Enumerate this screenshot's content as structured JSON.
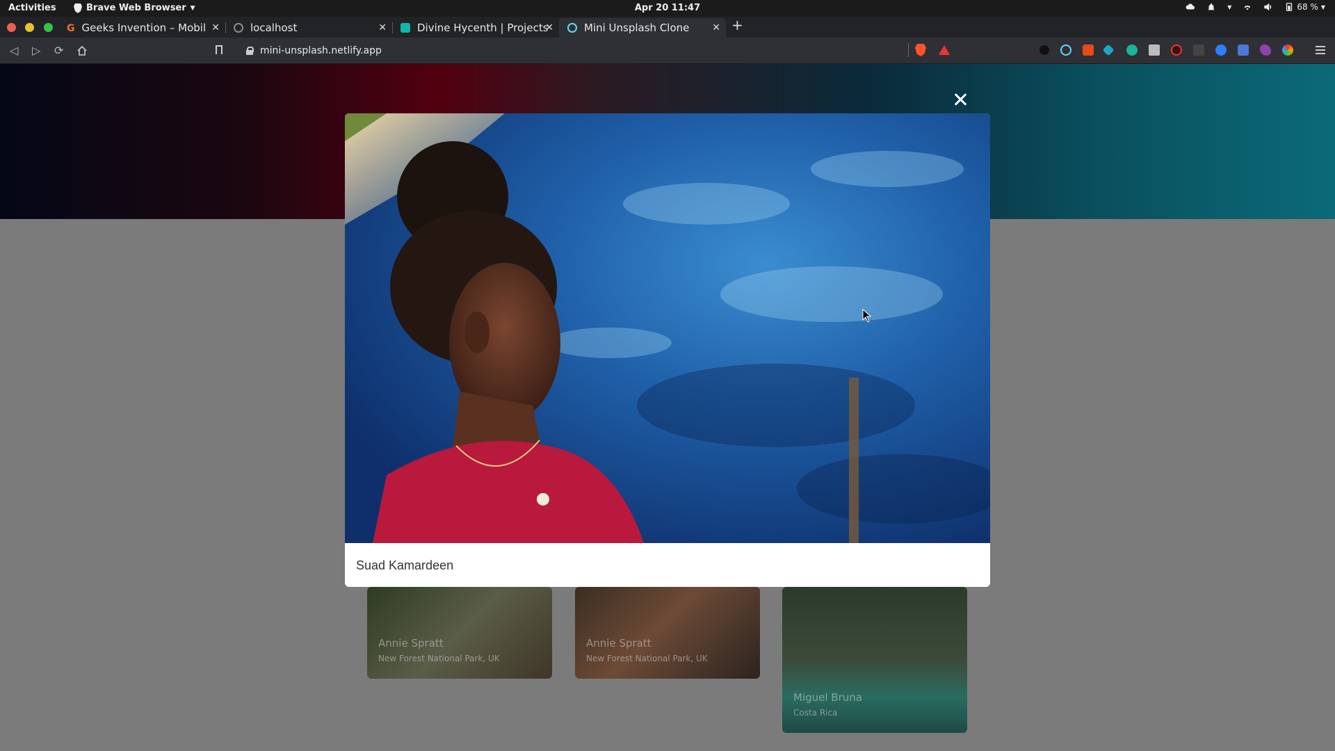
{
  "system_bar": {
    "activities": "Activities",
    "app_name": "Brave Web Browser",
    "clock": "Apr 20  11:47",
    "battery": "68 %"
  },
  "tabs": [
    {
      "label": "Geeks Invention – Mobile A",
      "favicon_color": "#f37121"
    },
    {
      "label": "localhost",
      "favicon_color": "#8a8a8a"
    },
    {
      "label": "Divine Hycenth | Projects",
      "favicon_color": "#13b5a6"
    },
    {
      "label": "Mini Unsplash Clone",
      "favicon_color": "#61dafb",
      "active": true
    }
  ],
  "address_bar": {
    "url": "mini-unsplash.netlify.app"
  },
  "modal": {
    "photo_description_icon": "portrait-photo",
    "caption": "Suad Kamardeen"
  },
  "cards": [
    {
      "name": "Annie Spratt",
      "location": "New Forest National Park, UK"
    },
    {
      "name": "Annie Spratt",
      "location": "New Forest National Park, UK"
    },
    {
      "name": "Miguel Bruna",
      "location": "Costa Rica"
    }
  ],
  "colors": {
    "accent_active_tab": "#2f3035",
    "modal_bg": "#ffffff",
    "page_overlay": "#7b7b7b"
  }
}
